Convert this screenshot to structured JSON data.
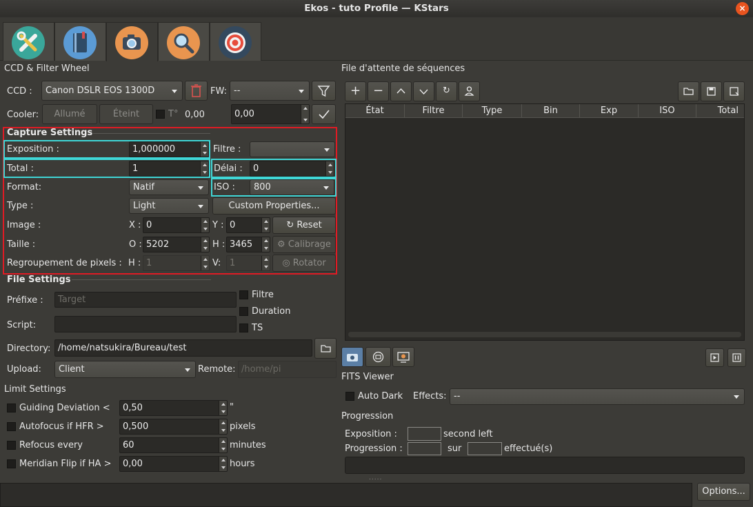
{
  "window": {
    "title": "Ekos - tuto Profile — KStars",
    "close": "×"
  },
  "tabs": [
    {
      "name": "setup-tab",
      "icon": "tools-icon"
    },
    {
      "name": "scheduler-tab",
      "icon": "notebook-icon"
    },
    {
      "name": "capture-tab",
      "icon": "camera-icon",
      "active": true
    },
    {
      "name": "focus-tab",
      "icon": "magnifier-icon"
    },
    {
      "name": "guide-tab",
      "icon": "target-icon"
    }
  ],
  "ccd_fw": {
    "title": "CCD & Filter Wheel",
    "ccd_label": "CCD :",
    "ccd_value": "Canon DSLR EOS 1300D",
    "fw_label": "FW:",
    "fw_value": "--",
    "cooler_label": "Cooler:",
    "cooler_on": "Allumé",
    "cooler_off": "Éteint",
    "temp_label": "T°",
    "temp_value": "0,00",
    "temp_setpoint": "0,00"
  },
  "capture_settings": {
    "title": "Capture Settings",
    "exposure_label": "Exposition :",
    "exposure_value": "1,000000",
    "filter_label": "Filtre :",
    "filter_value": "",
    "total_label": "Total :",
    "total_value": "1",
    "delay_label": "Délai :",
    "delay_value": "0",
    "format_label": "Format:",
    "format_value": "Natif",
    "iso_label": "ISO :",
    "iso_value": "800",
    "type_label": "Type :",
    "type_value": "Light",
    "custom_props": "Custom Properties...",
    "image_label": "Image :",
    "x_label": "X :",
    "x_value": "0",
    "y_label": "Y :",
    "y_value": "0",
    "reset": "Reset",
    "size_label": "Taille :",
    "w_label": "O :",
    "w_value": "5202",
    "h_label": "H :",
    "h_value": "3465",
    "calibration": "Calibrage",
    "binning_label": "Regroupement de pixels :",
    "bin_h_label": "H :",
    "bin_h_value": "1",
    "bin_v_label": "V:",
    "bin_v_value": "1",
    "rotator": "Rotator"
  },
  "file_settings": {
    "title": "File Settings",
    "prefix_label": "Préfixe :",
    "prefix_placeholder": "Target",
    "filter_chk": "Filtre",
    "duration_chk": "Duration",
    "ts_chk": "TS",
    "script_label": "Script:",
    "directory_label": "Directory:",
    "directory_value": "/home/natsukira/Bureau/test",
    "upload_label": "Upload:",
    "upload_value": "Client",
    "remote_label": "Remote:",
    "remote_placeholder": "/home/pi"
  },
  "limit_settings": {
    "title": "Limit Settings",
    "rows": [
      {
        "label": "Guiding Deviation <",
        "value": "0,50",
        "unit": "\""
      },
      {
        "label": "Autofocus if HFR >",
        "value": "0,500",
        "unit": "pixels"
      },
      {
        "label": "Refocus every",
        "value": "60",
        "unit": "minutes"
      },
      {
        "label": "Meridian Flip if HA >",
        "value": "0,00",
        "unit": "hours"
      }
    ]
  },
  "queue": {
    "title": "File d'attente de séquences",
    "columns": [
      "État",
      "Filtre",
      "Type",
      "Bin",
      "Exp",
      "ISO",
      "Total"
    ]
  },
  "fits": {
    "title": "FITS Viewer",
    "auto_dark": "Auto Dark",
    "effects_label": "Effects:",
    "effects_value": "--"
  },
  "progress": {
    "title": "Progression",
    "exposure_label": "Exposition :",
    "seconds_left": "second left",
    "progress_label": "Progression :",
    "sur": "sur",
    "done": "effectué(s)"
  },
  "footer": {
    "options": "Options...",
    "splitter": "....."
  },
  "colors": {
    "highlight_red": "#e01b24",
    "highlight_cyan": "#3fd7d7"
  }
}
